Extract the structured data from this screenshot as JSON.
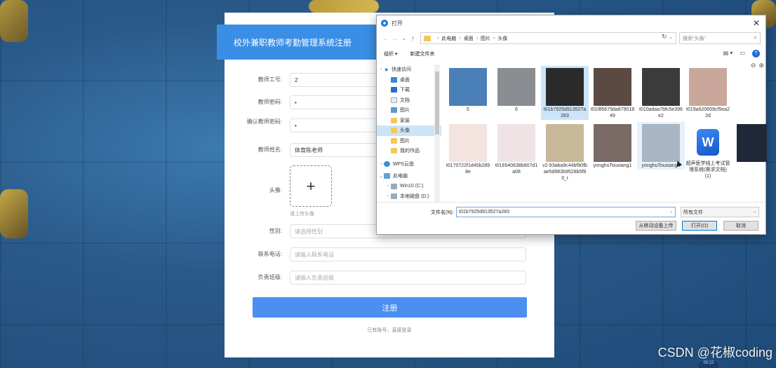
{
  "registration": {
    "title": "校外兼职教师考勤管理系统注册",
    "fields": [
      {
        "label": "教师工号:",
        "value": "2",
        "placeholder": ""
      },
      {
        "label": "教师密码:",
        "value": "•",
        "placeholder": ""
      },
      {
        "label": "确认教师密码:",
        "value": "•",
        "placeholder": ""
      },
      {
        "label": "教师姓名:",
        "value": "体育陈老师",
        "placeholder": ""
      }
    ],
    "avatar_label": "头像:",
    "upload_hint": "请上传头像",
    "gender": {
      "label": "性别:",
      "placeholder": "请选择性别"
    },
    "phone": {
      "label": "联系电话:",
      "placeholder": "请输入联系电话"
    },
    "class_field": {
      "label": "负责班级:",
      "placeholder": "请输入负责班级"
    },
    "submit_label": "注册",
    "login_link": "已有账号，直接登录"
  },
  "dialog": {
    "title": "打开",
    "breadcrumb": [
      "此电脑",
      "桌面",
      "图片",
      "头像"
    ],
    "search_placeholder": "搜索\"头像\"",
    "toolbar": {
      "organize": "组织 ▾",
      "new_folder": "新建文件夹"
    },
    "nav_items": [
      {
        "label": "快速访问",
        "icon": "ni-star",
        "pinned": false,
        "indent": 0,
        "chev": "›"
      },
      {
        "label": "桌面",
        "icon": "ni-desk",
        "pinned": true,
        "indent": 1,
        "chev": ""
      },
      {
        "label": "下载",
        "icon": "ni-down",
        "pinned": true,
        "indent": 1,
        "chev": ""
      },
      {
        "label": "文档",
        "icon": "ni-doc",
        "pinned": true,
        "indent": 1,
        "chev": ""
      },
      {
        "label": "图片",
        "icon": "ni-pic",
        "pinned": true,
        "indent": 1,
        "chev": ""
      },
      {
        "label": "家装",
        "icon": "ni-folder",
        "pinned": false,
        "indent": 1,
        "chev": ""
      },
      {
        "label": "头像",
        "icon": "ni-folder",
        "pinned": false,
        "indent": 1,
        "chev": "",
        "selected": true
      },
      {
        "label": "图片",
        "icon": "ni-folder",
        "pinned": false,
        "indent": 1,
        "chev": ""
      },
      {
        "label": "我的作品",
        "icon": "ni-folder",
        "pinned": false,
        "indent": 1,
        "chev": ""
      },
      {
        "label": "WPS云盘",
        "icon": "ni-cloud",
        "pinned": false,
        "indent": 0,
        "chev": "›"
      },
      {
        "label": "此电脑",
        "icon": "ni-pc",
        "pinned": false,
        "indent": 0,
        "chev": "⌄"
      },
      {
        "label": "Win10 (C:)",
        "icon": "ni-drive",
        "pinned": false,
        "indent": 1,
        "chev": "›"
      },
      {
        "label": "本地磁盘 (D:)",
        "icon": "ni-drive",
        "pinned": false,
        "indent": 1,
        "chev": "›"
      }
    ],
    "files": [
      {
        "name": "5",
        "color": "#4a7fb8"
      },
      {
        "name": "6",
        "color": "#8a8d92"
      },
      {
        "name": "t01b7925d913527a283",
        "color": "#2a2a2a",
        "state": "selected"
      },
      {
        "name": "t01f85679da87901849",
        "color": "#5a4a42"
      },
      {
        "name": "t010adaa7bfc5e396e2",
        "color": "#3b3b3b"
      },
      {
        "name": "t019a620659cf5ea22d",
        "color": "#c9a79a"
      },
      {
        "name": "t0170722f1d45b2898e",
        "color": "#f3e4e0"
      },
      {
        "name": "t016540638b807d1a08",
        "color": "#efe3e6"
      },
      {
        "name": "v2-93aba9c44bf90fbae5d983b9528b5f93_r",
        "color": "#c8b89a"
      },
      {
        "name": "yonghuTouxiang1",
        "color": "#7a6a66"
      },
      {
        "name": "yonghuTouxiang4",
        "color": "#a8b6c4",
        "state": "hover"
      },
      {
        "name": "超声医学线上考试管理系统(需求文档) (1)",
        "color": "#1f6fe0"
      },
      {
        "name": "",
        "color": "#1e2838"
      }
    ],
    "file_name_label": "文件名(N):",
    "file_name_value": "t01b7925d913527a283",
    "file_type": "所有文件",
    "buttons": {
      "mobile": "从移动设备上传",
      "open": "打开(O)",
      "cancel": "取消"
    }
  },
  "watermark": "CSDN @花椒coding",
  "corner_badge": "00:22"
}
